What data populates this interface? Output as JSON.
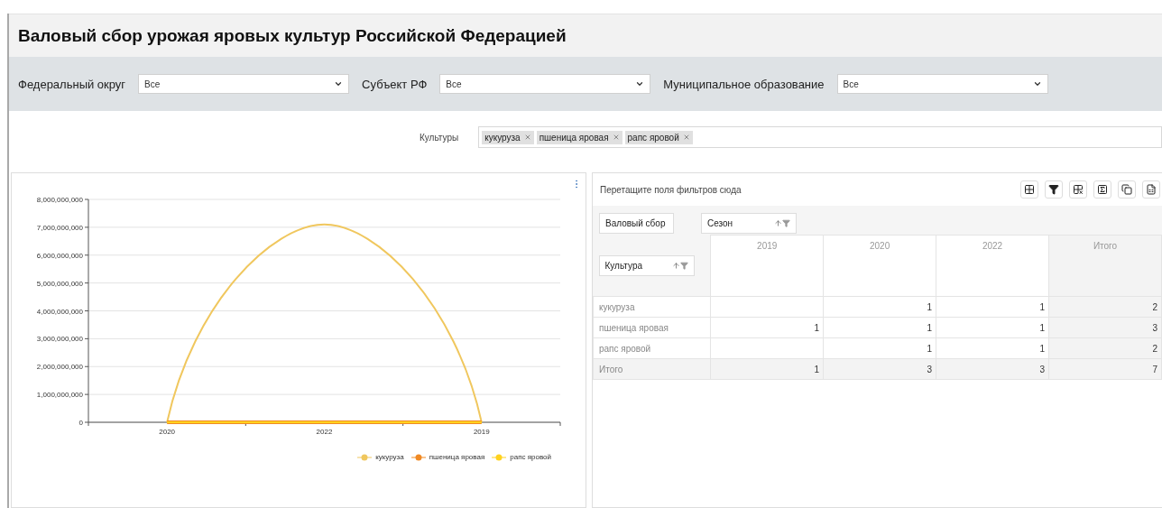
{
  "title": "Валовый сбор урожая яровых культур Российской Федерацией",
  "filters": [
    {
      "label": "Федеральный округ",
      "value": "Все"
    },
    {
      "label": "Субъект РФ",
      "value": "Все"
    },
    {
      "label": "Муниципальное образование",
      "value": "Все"
    }
  ],
  "crops_filter": {
    "label": "Культуры",
    "tags": [
      "кукуруза",
      "пшеница яровая",
      "рапс яровой"
    ]
  },
  "chart": {
    "chart_data": {
      "type": "line",
      "categories": [
        "2020",
        "2022",
        "2019"
      ],
      "series": [
        {
          "name": "кукуруза",
          "color": "#f0c75e",
          "values": [
            0,
            7100000000,
            0
          ]
        },
        {
          "name": "пшеница яровая",
          "color": "#f08a24",
          "values": [
            0,
            0,
            0
          ]
        },
        {
          "name": "рапс яровой",
          "color": "#ffd21f",
          "values": [
            0,
            0,
            0
          ]
        }
      ],
      "ylim": [
        0,
        8000000000
      ],
      "grid": true,
      "legend": true,
      "yticks": [
        {
          "value": 0,
          "label": "0"
        },
        {
          "value": 1000000000,
          "label": "1,000,000,000"
        },
        {
          "value": 2000000000,
          "label": "2,000,000,000"
        },
        {
          "value": 3000000000,
          "label": "3,000,000,000"
        },
        {
          "value": 4000000000,
          "label": "4,000,000,000"
        },
        {
          "value": 5000000000,
          "label": "5,000,000,000"
        },
        {
          "value": 6000000000,
          "label": "6,000,000,000"
        },
        {
          "value": 7000000000,
          "label": "7,000,000,000"
        },
        {
          "value": 8000000000,
          "label": "8,000,000,000"
        }
      ]
    }
  },
  "pivot": {
    "drop_hint": "Перетащите поля фильтров сюда",
    "toolbar": [
      {
        "kind": "grid"
      },
      {
        "kind": "filter"
      },
      {
        "kind": "clear"
      },
      {
        "kind": "expand"
      },
      {
        "kind": "copy"
      },
      {
        "kind": "export"
      }
    ],
    "data_field": "Валовый сбор",
    "column_field": "Сезон",
    "row_field": "Культура",
    "columns": [
      "2019",
      "2020",
      "2022",
      "Итого"
    ],
    "rows": [
      {
        "label": "кукуруза",
        "cells": [
          null,
          "1",
          "1",
          "2"
        ]
      },
      {
        "label": "пшеница яровая",
        "cells": [
          "1",
          "1",
          "1",
          "3"
        ]
      },
      {
        "label": "рапс яровой",
        "cells": [
          null,
          "1",
          "1",
          "2"
        ]
      }
    ],
    "total_row": {
      "label": "Итого",
      "cells": [
        "1",
        "3",
        "3",
        "7"
      ]
    }
  }
}
